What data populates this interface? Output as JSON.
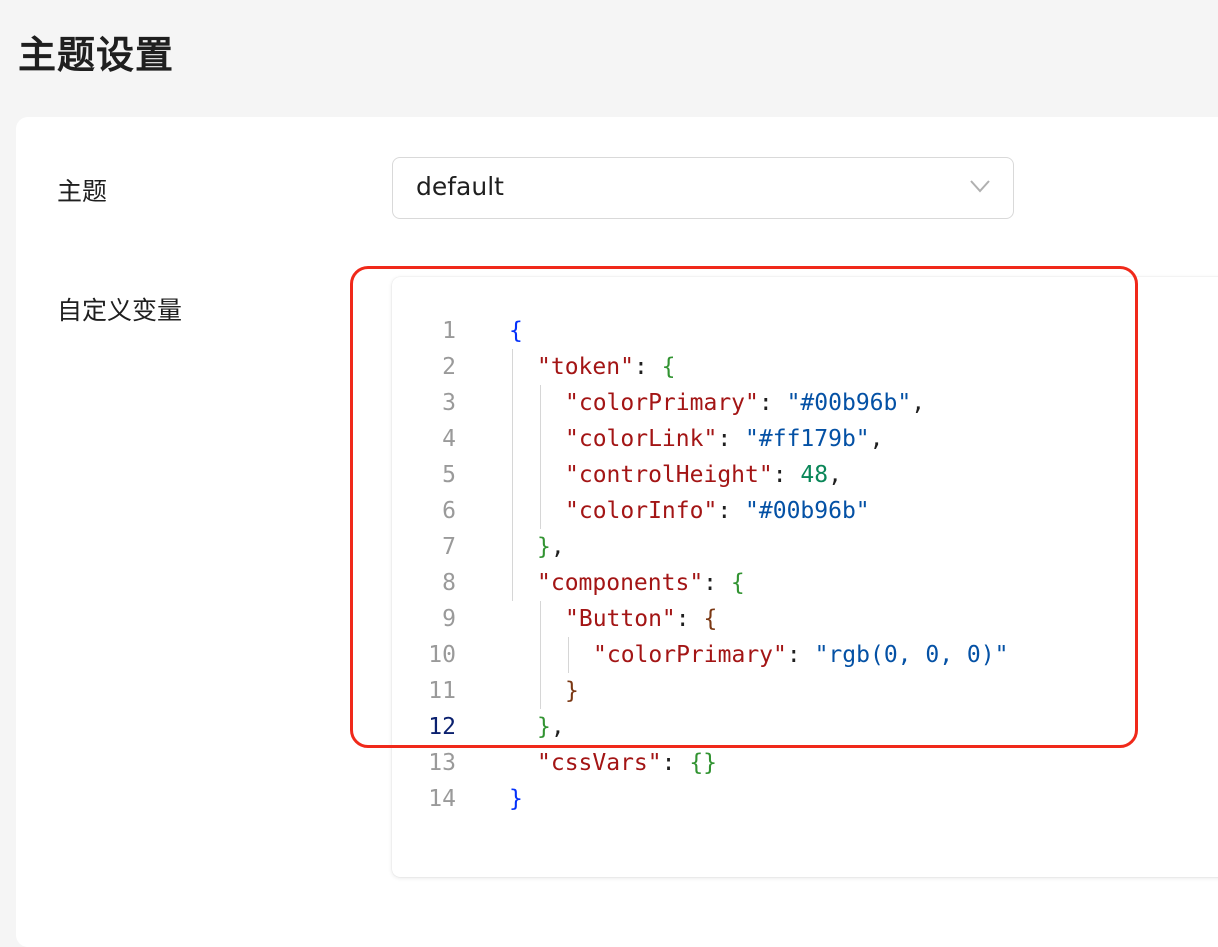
{
  "page": {
    "title": "主题设置"
  },
  "form": {
    "theme_label": "主题",
    "theme_value": "default",
    "vars_label": "自定义变量"
  },
  "editor": {
    "active_line": 12,
    "lines": [
      {
        "num": "1",
        "tokens": [
          {
            "t": "{",
            "c": "b1"
          }
        ]
      },
      {
        "num": "2",
        "tokens": [
          {
            "t": "\"token\"",
            "c": "k"
          },
          {
            "t": ": ",
            "c": "p"
          },
          {
            "t": "{",
            "c": "b2"
          }
        ]
      },
      {
        "num": "3",
        "tokens": [
          {
            "t": "\"colorPrimary\"",
            "c": "k"
          },
          {
            "t": ": ",
            "c": "p"
          },
          {
            "t": "\"#00b96b\"",
            "c": "s"
          },
          {
            "t": ",",
            "c": "p"
          }
        ]
      },
      {
        "num": "4",
        "tokens": [
          {
            "t": "\"colorLink\"",
            "c": "k"
          },
          {
            "t": ": ",
            "c": "p"
          },
          {
            "t": "\"#ff179b\"",
            "c": "s"
          },
          {
            "t": ",",
            "c": "p"
          }
        ]
      },
      {
        "num": "5",
        "tokens": [
          {
            "t": "\"controlHeight\"",
            "c": "k"
          },
          {
            "t": ": ",
            "c": "p"
          },
          {
            "t": "48",
            "c": "n"
          },
          {
            "t": ",",
            "c": "p"
          }
        ]
      },
      {
        "num": "6",
        "tokens": [
          {
            "t": "\"colorInfo\"",
            "c": "k"
          },
          {
            "t": ": ",
            "c": "p"
          },
          {
            "t": "\"#00b96b\"",
            "c": "s"
          }
        ]
      },
      {
        "num": "7",
        "tokens": [
          {
            "t": "}",
            "c": "b2"
          },
          {
            "t": ",",
            "c": "p"
          }
        ]
      },
      {
        "num": "8",
        "tokens": [
          {
            "t": "\"components\"",
            "c": "k"
          },
          {
            "t": ": ",
            "c": "p"
          },
          {
            "t": "{",
            "c": "b2"
          }
        ]
      },
      {
        "num": "9",
        "tokens": [
          {
            "t": "\"Button\"",
            "c": "k"
          },
          {
            "t": ": ",
            "c": "p"
          },
          {
            "t": "{",
            "c": "b3"
          }
        ]
      },
      {
        "num": "10",
        "tokens": [
          {
            "t": "\"colorPrimary\"",
            "c": "k"
          },
          {
            "t": ": ",
            "c": "p"
          },
          {
            "t": "\"rgb(0, 0, 0)\"",
            "c": "s"
          }
        ]
      },
      {
        "num": "11",
        "tokens": [
          {
            "t": "}",
            "c": "b3"
          }
        ]
      },
      {
        "num": "12",
        "tokens": [
          {
            "t": "}",
            "c": "b2"
          },
          {
            "t": ",",
            "c": "p"
          }
        ]
      },
      {
        "num": "13",
        "tokens": [
          {
            "t": "\"cssVars\"",
            "c": "k"
          },
          {
            "t": ": ",
            "c": "p"
          },
          {
            "t": "{}",
            "c": "b2"
          }
        ]
      },
      {
        "num": "14",
        "tokens": [
          {
            "t": "}",
            "c": "b1"
          }
        ]
      }
    ]
  },
  "colors": {
    "highlight": "#f0291a",
    "key": "#a31515",
    "string": "#0451a5",
    "number": "#098658"
  }
}
